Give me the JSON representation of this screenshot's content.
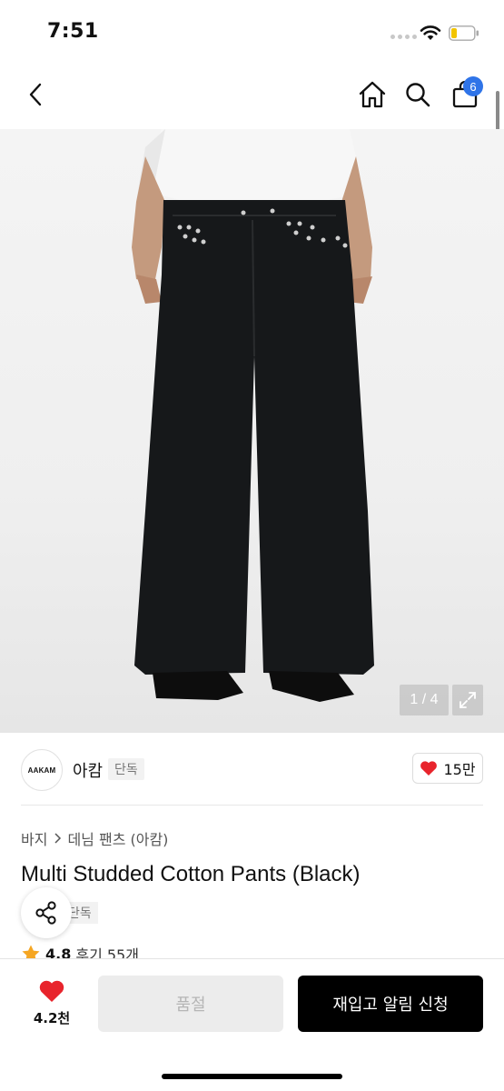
{
  "status_bar": {
    "time": "7:51"
  },
  "nav": {
    "back_icon": "chevron-left-icon",
    "home_icon": "home-icon",
    "search_icon": "search-icon",
    "cart_icon": "shopping-bag-icon",
    "cart_badge": "6"
  },
  "image": {
    "counter": "1 / 4",
    "expand_icon": "expand-icon"
  },
  "brand": {
    "logo_text": "AAKAM",
    "name": "아캄",
    "tag": "단독",
    "like_count": "15만"
  },
  "breadcrumb": {
    "category": "바지",
    "sub_category": "데님 팬츠 (아캄)"
  },
  "product": {
    "title": "Multi Studded Cotton Pants (Black)",
    "exclusive_tag": "단독",
    "rating": "4.8",
    "reviews": "후기 55개"
  },
  "actions": {
    "wish_count": "4.2천",
    "soldout_label": "품절",
    "restock_label": "재입고 알림 신청"
  },
  "colors": {
    "badge": "#2f74e8",
    "heart": "#e8242c",
    "star": "#f5a623",
    "primary_button": "#000000"
  }
}
